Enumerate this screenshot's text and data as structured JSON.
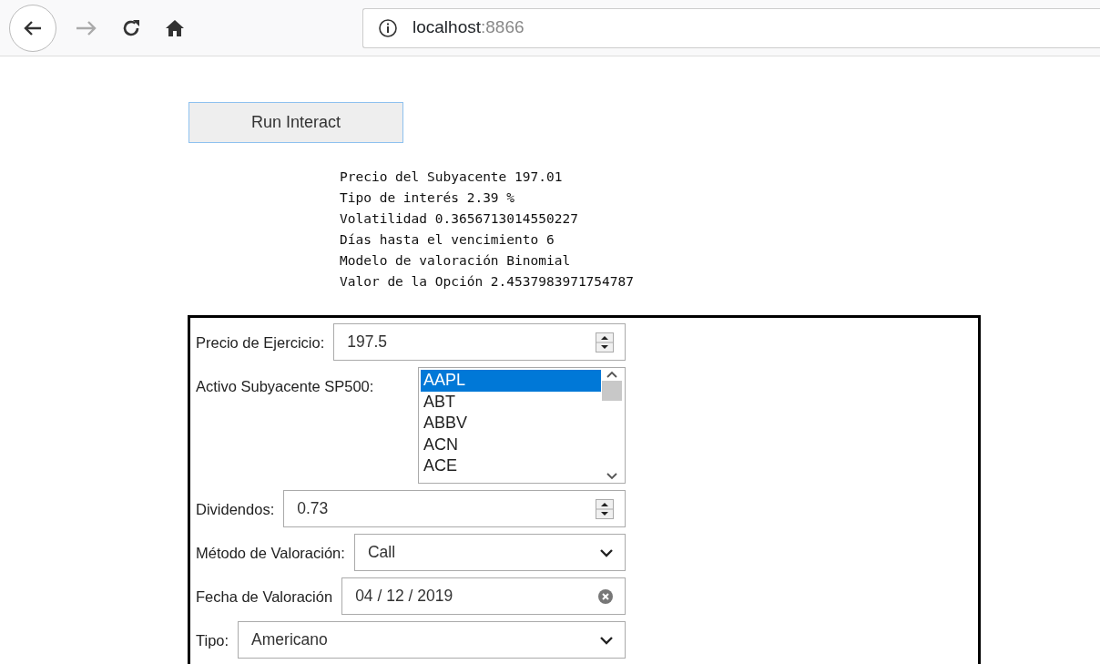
{
  "browser": {
    "url_host": "localhost",
    "url_port": ":8866",
    "back_enabled": true,
    "forward_enabled": false
  },
  "run_button": "Run Interact",
  "output_lines": [
    "Precio del Subyacente 197.01",
    "Tipo de interés 2.39 %",
    "Volatilidad 0.3656713014550227",
    "Días hasta el vencimiento 6",
    "Modelo de valoración Binomial",
    "Valor de la Opción 2.4537983971754787"
  ],
  "form": {
    "fields": [
      {
        "kind": "number",
        "label": "Precio de Ejercicio:",
        "value": "197.5"
      },
      {
        "kind": "listbox",
        "label": "Activo Subyacente SP500:",
        "options": [
          {
            "label": "AAPL",
            "selected": true
          },
          {
            "label": "ABT",
            "selected": false
          },
          {
            "label": "ABBV",
            "selected": false
          },
          {
            "label": "ACN",
            "selected": false
          },
          {
            "label": "ACE",
            "selected": false
          }
        ]
      },
      {
        "kind": "number",
        "label": "Dividendos:",
        "value": "0.73"
      },
      {
        "kind": "select",
        "label": "Método de Valoración:",
        "value": "Call"
      },
      {
        "kind": "date",
        "label": "Fecha de Valoración",
        "value": "04 / 12 / 2019"
      },
      {
        "kind": "select",
        "label": "Tipo:",
        "value": "Americano"
      }
    ]
  }
}
